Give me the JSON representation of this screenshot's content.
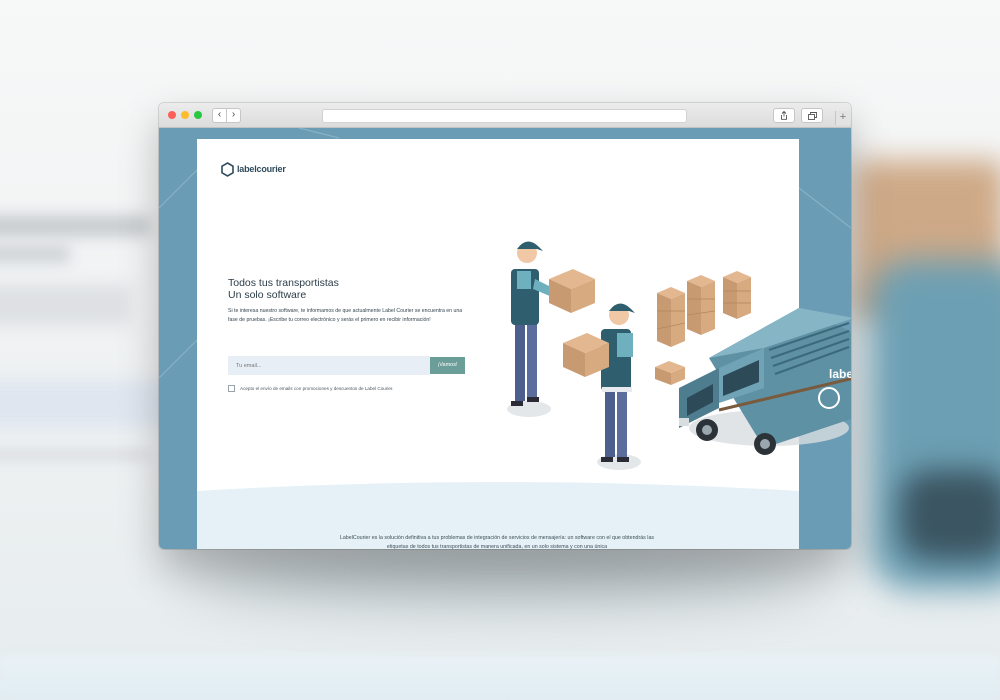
{
  "browser": {
    "url": "",
    "nav": {
      "back": "‹",
      "forward": "›"
    },
    "toolbar": {
      "share_icon": "share-icon",
      "tabs_icon": "tabs-icon",
      "new_tab": "+"
    }
  },
  "page": {
    "logo": {
      "prefix": "label",
      "suffix": "courier"
    },
    "headline": {
      "line1": "Todos tus transportistas",
      "line2": "Un solo software"
    },
    "description": "Si te interesa nuestro software, te informamos de que actualmente Label Courier se encuentra en una fase de pruebas. ¡Escribe tu correo electrónico y serás el primero en recibir información!",
    "form": {
      "email_placeholder": "Tu email...",
      "submit_label": "¡Vamos!",
      "consent_label": "Acepto el envío de emails con promociones y descuentos de Label Courier."
    },
    "truck_brand": "label",
    "footer_text": "LabelCourier es la solución definitiva a tus problemas de integración de servicios de mensajería: un software con el que obtendrás las etiquetas de todos tus transportistas de manera unificada, en un solo sistema y con una única"
  },
  "colors": {
    "frame_blue": "#6a9cb5",
    "button_teal": "#6b9e99",
    "input_bg": "#e8eef6",
    "text_dark": "#2b3d48"
  }
}
